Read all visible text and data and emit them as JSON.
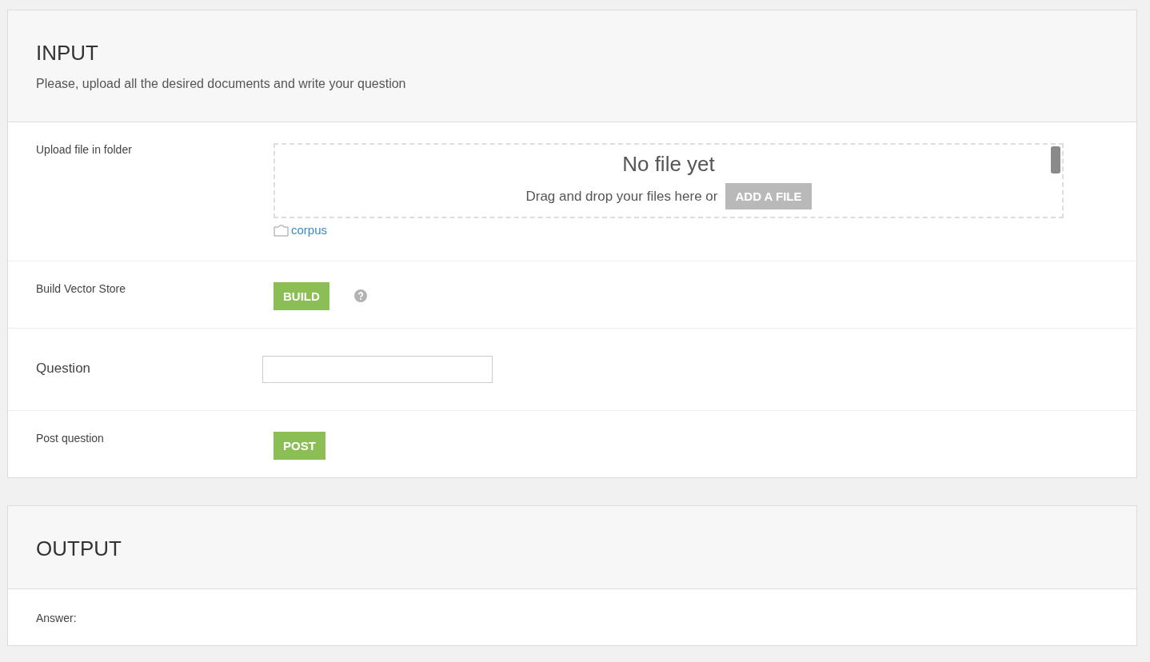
{
  "input_section": {
    "title": "INPUT",
    "subtitle": "Please, upload all the desired documents and write your question",
    "rows": [
      {
        "kind": "upload",
        "label": "Upload file in folder",
        "dropzone": {
          "title": "No file yet",
          "hint": "Drag and drop your files here or",
          "button": "ADD A FILE"
        },
        "folder": "corpus"
      },
      {
        "kind": "button",
        "label": "Build Vector Store",
        "button": "BUILD",
        "help": true
      },
      {
        "kind": "text_input",
        "label": "Question"
      },
      {
        "kind": "button",
        "label": "Post question",
        "button": "POST",
        "help": false
      }
    ]
  },
  "output_section": {
    "title": "OUTPUT",
    "rows": [
      {
        "label": "Answer:"
      }
    ]
  }
}
